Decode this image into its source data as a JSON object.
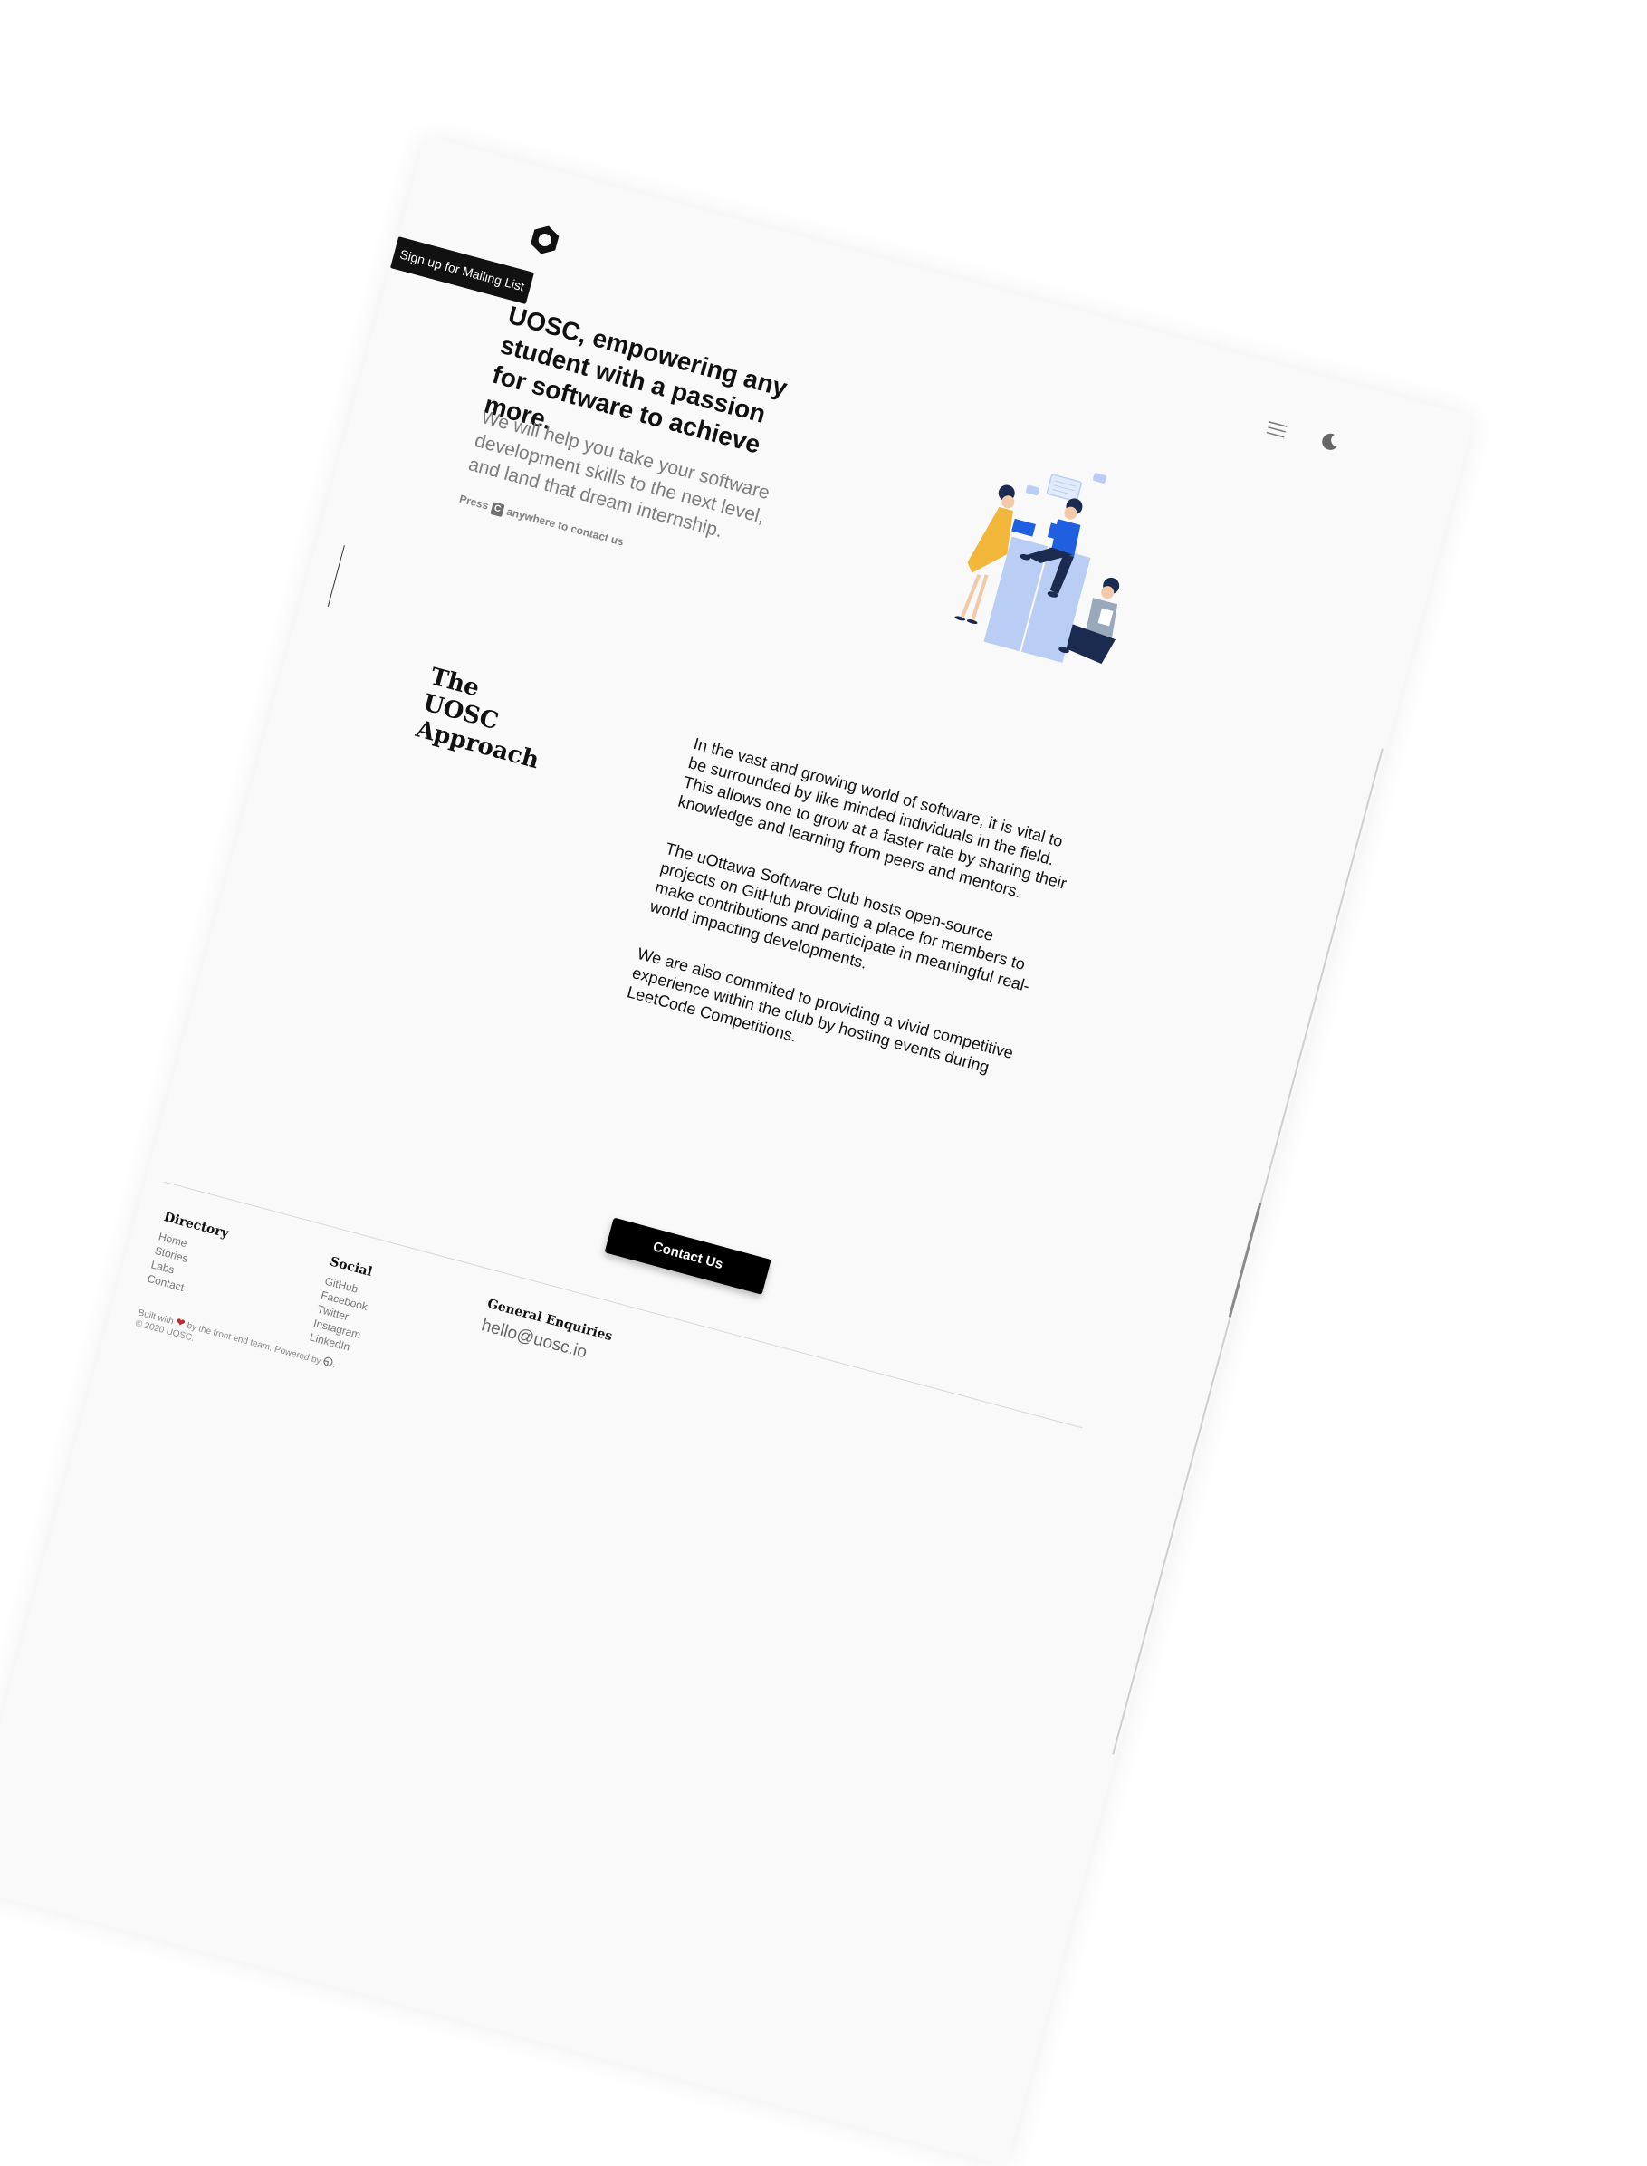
{
  "header": {
    "mailing_label": "Sign up for Mailing List",
    "logo_icon": "hexagon-logo-icon",
    "menu_icon": "hamburger-menu-icon",
    "theme_icon": "moon-icon"
  },
  "hero": {
    "title": "UOSC, empowering any student with a passion for software to achieve more.",
    "subtitle": "We will help you take your software development skills to the next level, and land that dream internship.",
    "hint_prefix": "Press",
    "hint_key": "C",
    "hint_suffix": "anywhere to contact us"
  },
  "approach": {
    "title": "The UOSC Approach",
    "paragraphs": [
      "In the vast and growing world of software, it is vital to be surrounded by like minded individuals in the field. This allows one to grow at a faster rate by sharing their knowledge and learning from peers and mentors.",
      "The uOttawa Software Club hosts open-source projects on GitHub providing a place for members to make contributions and participate in meaningful real-world impacting developments.",
      "We are also commited to providing a vivid competitive experience within the club by hosting events during LeetCode Competitions."
    ]
  },
  "cta": {
    "contact_label": "Contact Us"
  },
  "footer": {
    "directory_title": "Directory",
    "directory_links": [
      "Home",
      "Stories",
      "Labs",
      "Contact"
    ],
    "social_title": "Social",
    "social_links": [
      "GitHub",
      "Facebook",
      "Twitter",
      "Instagram",
      "LinkedIn"
    ],
    "enquiries_title": "General Enquiries",
    "enquiries_email": "hello@uosc.io",
    "credits_prefix": "Built with",
    "credits_middle": "by the front end team. Powered by",
    "credits_suffix": ".",
    "copyright": "© 2020 UOSC."
  },
  "colors": {
    "page_bg": "#f9f9f9",
    "button_bg": "#111111",
    "muted_text": "#7d7d7d",
    "heart": "#c62828",
    "illustration_blue": "#1f5fe0",
    "illustration_light_blue": "#b9cdf5",
    "illustration_yellow": "#f2b73a",
    "illustration_navy": "#1b2b4f"
  }
}
